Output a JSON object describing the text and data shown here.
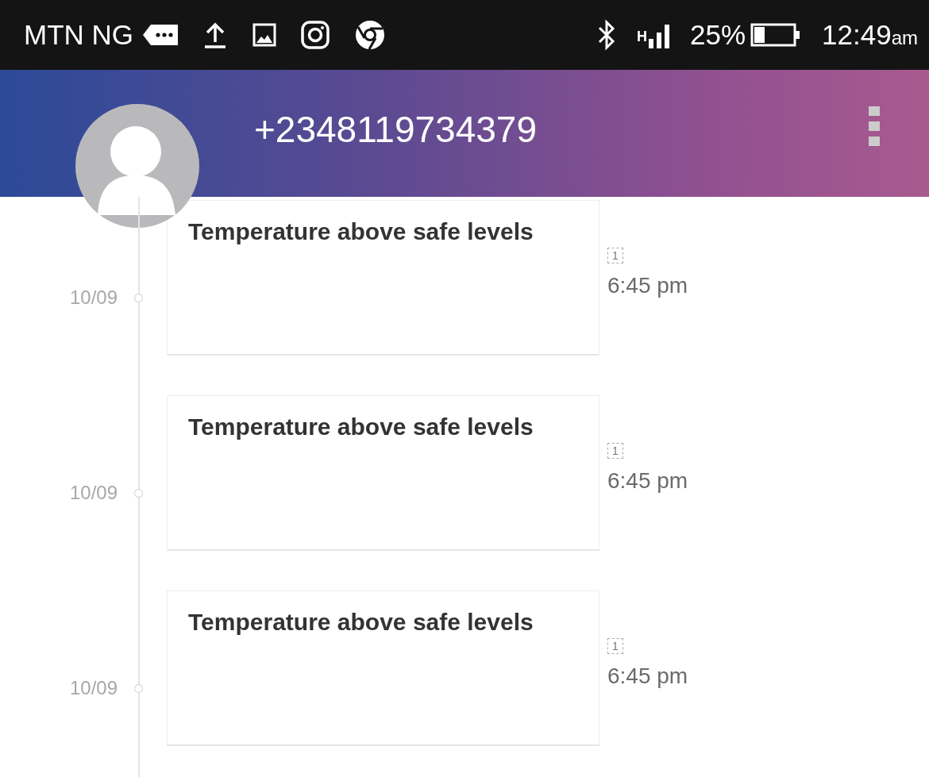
{
  "status_bar": {
    "carrier": "MTN NG",
    "network": "H",
    "battery": "25%",
    "time": "12:49",
    "time_suffix": "am"
  },
  "header": {
    "title": "+2348119734379"
  },
  "messages": [
    {
      "date": "10/09",
      "text": "Temperature above safe levels",
      "sim": "1",
      "time": "6:45 pm"
    },
    {
      "date": "10/09",
      "text": "Temperature above safe levels",
      "sim": "1",
      "time": "6:45 pm"
    },
    {
      "date": "10/09",
      "text": "Temperature above safe levels",
      "sim": "1",
      "time": "6:45 pm"
    }
  ]
}
